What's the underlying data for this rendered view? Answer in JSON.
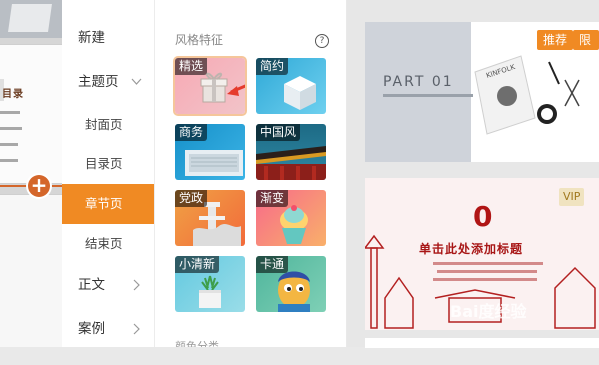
{
  "nav": {
    "new": "新建",
    "theme": "主题页",
    "cover": "封面页",
    "toc": "目录页",
    "section": "章节页",
    "end": "结束页",
    "body": "正文",
    "cases": "案例"
  },
  "background": {
    "slide_title": "目录"
  },
  "panel": {
    "title": "风格特征",
    "help": "?",
    "bottom_label": "颜色分类",
    "tiles": [
      {
        "label": "精选",
        "icon": "gift-box-icon"
      },
      {
        "label": "简约",
        "icon": "cube-icon"
      },
      {
        "label": "商务",
        "icon": "laptop-icon"
      },
      {
        "label": "中国风",
        "icon": "palace-icon"
      },
      {
        "label": "党政",
        "icon": "pillar-icon"
      },
      {
        "label": "渐变",
        "icon": "icecream-icon"
      },
      {
        "label": "小清新",
        "icon": "plant-icon"
      },
      {
        "label": "卡通",
        "icon": "cartoon-character-icon"
      }
    ]
  },
  "previews": {
    "card1": {
      "title": "PART 01",
      "badges": [
        "推荐",
        "限免"
      ],
      "magazine": "KINFOLK"
    },
    "card2": {
      "number": "0",
      "headline": "单击此处添加标题",
      "vip": "VIP"
    }
  },
  "watermark": "Bai度经验",
  "colors": {
    "accent": "#f08a23",
    "add_button": "#d4662a"
  }
}
